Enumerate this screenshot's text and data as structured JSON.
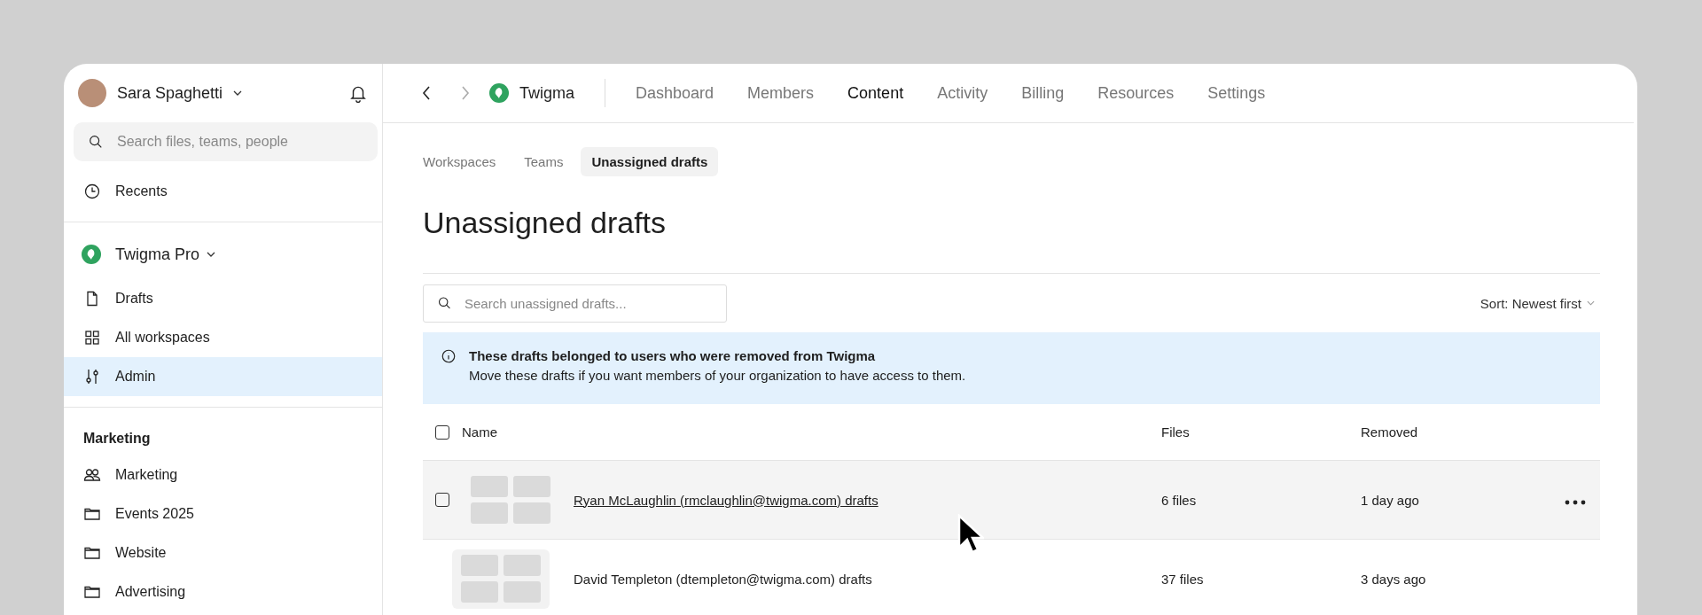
{
  "sidebar": {
    "user": {
      "name": "Sara Spaghetti"
    },
    "search": {
      "placeholder": "Search files, teams, people"
    },
    "top_items": [
      {
        "label": "Recents",
        "kind": "clock",
        "selected": false
      }
    ],
    "team": {
      "name": "Twigma Pro"
    },
    "team_items": [
      {
        "label": "Drafts",
        "kind": "file",
        "selected": false
      },
      {
        "label": "All workspaces",
        "kind": "grid",
        "selected": false
      },
      {
        "label": "Admin",
        "kind": "sliders",
        "selected": true
      }
    ],
    "section": {
      "title": "Marketing",
      "items": [
        {
          "label": "Marketing",
          "kind": "people",
          "selected": false
        },
        {
          "label": "Events 2025",
          "kind": "folder",
          "selected": false
        },
        {
          "label": "Website",
          "kind": "folder",
          "selected": false
        },
        {
          "label": "Advertising",
          "kind": "folder",
          "selected": false
        }
      ]
    }
  },
  "topbar": {
    "org": "Twigma",
    "tabs": [
      {
        "label": "Dashboard",
        "selected": false
      },
      {
        "label": "Members",
        "selected": false
      },
      {
        "label": "Content",
        "selected": true
      },
      {
        "label": "Activity",
        "selected": false
      },
      {
        "label": "Billing",
        "selected": false
      },
      {
        "label": "Resources",
        "selected": false
      },
      {
        "label": "Settings",
        "selected": false
      }
    ]
  },
  "subtabs": [
    {
      "label": "Workspaces",
      "selected": false
    },
    {
      "label": "Teams",
      "selected": false
    },
    {
      "label": "Unassigned drafts",
      "selected": true
    }
  ],
  "page_title": "Unassigned drafts",
  "search": {
    "placeholder": "Search unassigned drafts..."
  },
  "sort": "Sort: Newest first",
  "banner": {
    "title": "These drafts belonged to users who were removed from Twigma",
    "text": "Move these drafts if you want members of your organization to have access to them."
  },
  "table": {
    "select_all": {
      "checked": false
    },
    "columns": [
      "Name",
      "Files",
      "Removed"
    ],
    "rows": [
      {
        "name": "Ryan McLaughlin (rmclaughlin@twigma.com) drafts",
        "files": "6 files",
        "removed": "1 day ago",
        "hovered": true,
        "checked": false
      },
      {
        "name": "David Templeton (dtempleton@twigma.com) drafts",
        "files": "37 files",
        "removed": "3 days ago",
        "hovered": false
      }
    ]
  }
}
